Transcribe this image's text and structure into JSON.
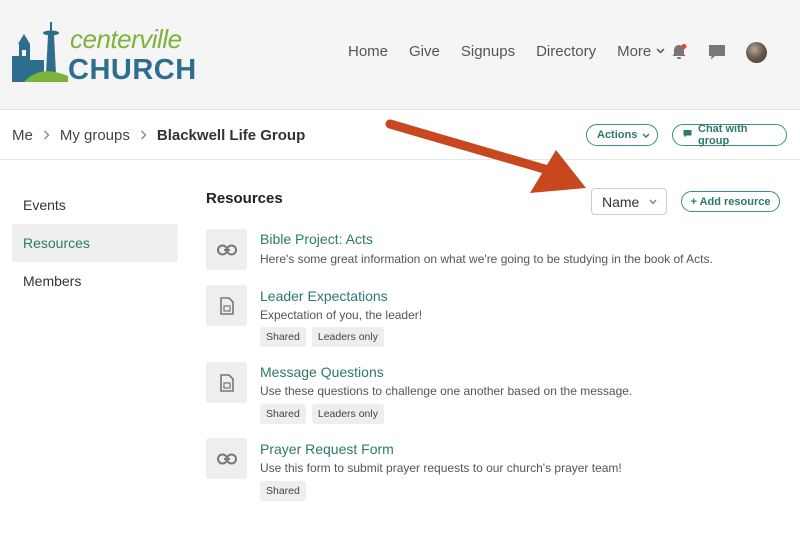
{
  "brand": {
    "name_top": "centerville",
    "name_bottom": "CHURCH",
    "colors": {
      "green": "#7bb33b",
      "blue": "#2f6d8f",
      "accent": "#2b7a6a",
      "annotation_arrow": "#c8471f"
    }
  },
  "nav": {
    "items": [
      "Home",
      "Give",
      "Signups",
      "Directory"
    ],
    "more_label": "More",
    "icons": [
      "bell-icon",
      "chat-icon",
      "avatar"
    ]
  },
  "breadcrumb": {
    "items": [
      "Me",
      "My groups"
    ],
    "current": "Blackwell Life Group"
  },
  "header_actions": {
    "actions_label": "Actions",
    "chat_label": "Chat with group"
  },
  "sidebar": {
    "items": [
      {
        "label": "Events",
        "active": false
      },
      {
        "label": "Resources",
        "active": true
      },
      {
        "label": "Members",
        "active": false
      }
    ]
  },
  "main": {
    "title": "Resources",
    "sort": {
      "selected": "Name"
    },
    "add_label": "+ Add resource",
    "resources": [
      {
        "icon": "link-icon",
        "name": "Bible Project: Acts",
        "description": "Here's some great information on what we're going to be studying in the book of Acts.",
        "tags": []
      },
      {
        "icon": "file-icon",
        "name": "Leader Expectations",
        "description": "Expectation of you, the leader!",
        "tags": [
          "Shared",
          "Leaders only"
        ]
      },
      {
        "icon": "file-icon",
        "name": "Message Questions",
        "description": "Use these questions to challenge one another based on the message.",
        "tags": [
          "Shared",
          "Leaders only"
        ]
      },
      {
        "icon": "link-icon",
        "name": "Prayer Request Form",
        "description": "Use this form to submit prayer requests to our church's prayer team!",
        "tags": [
          "Shared"
        ]
      }
    ]
  }
}
